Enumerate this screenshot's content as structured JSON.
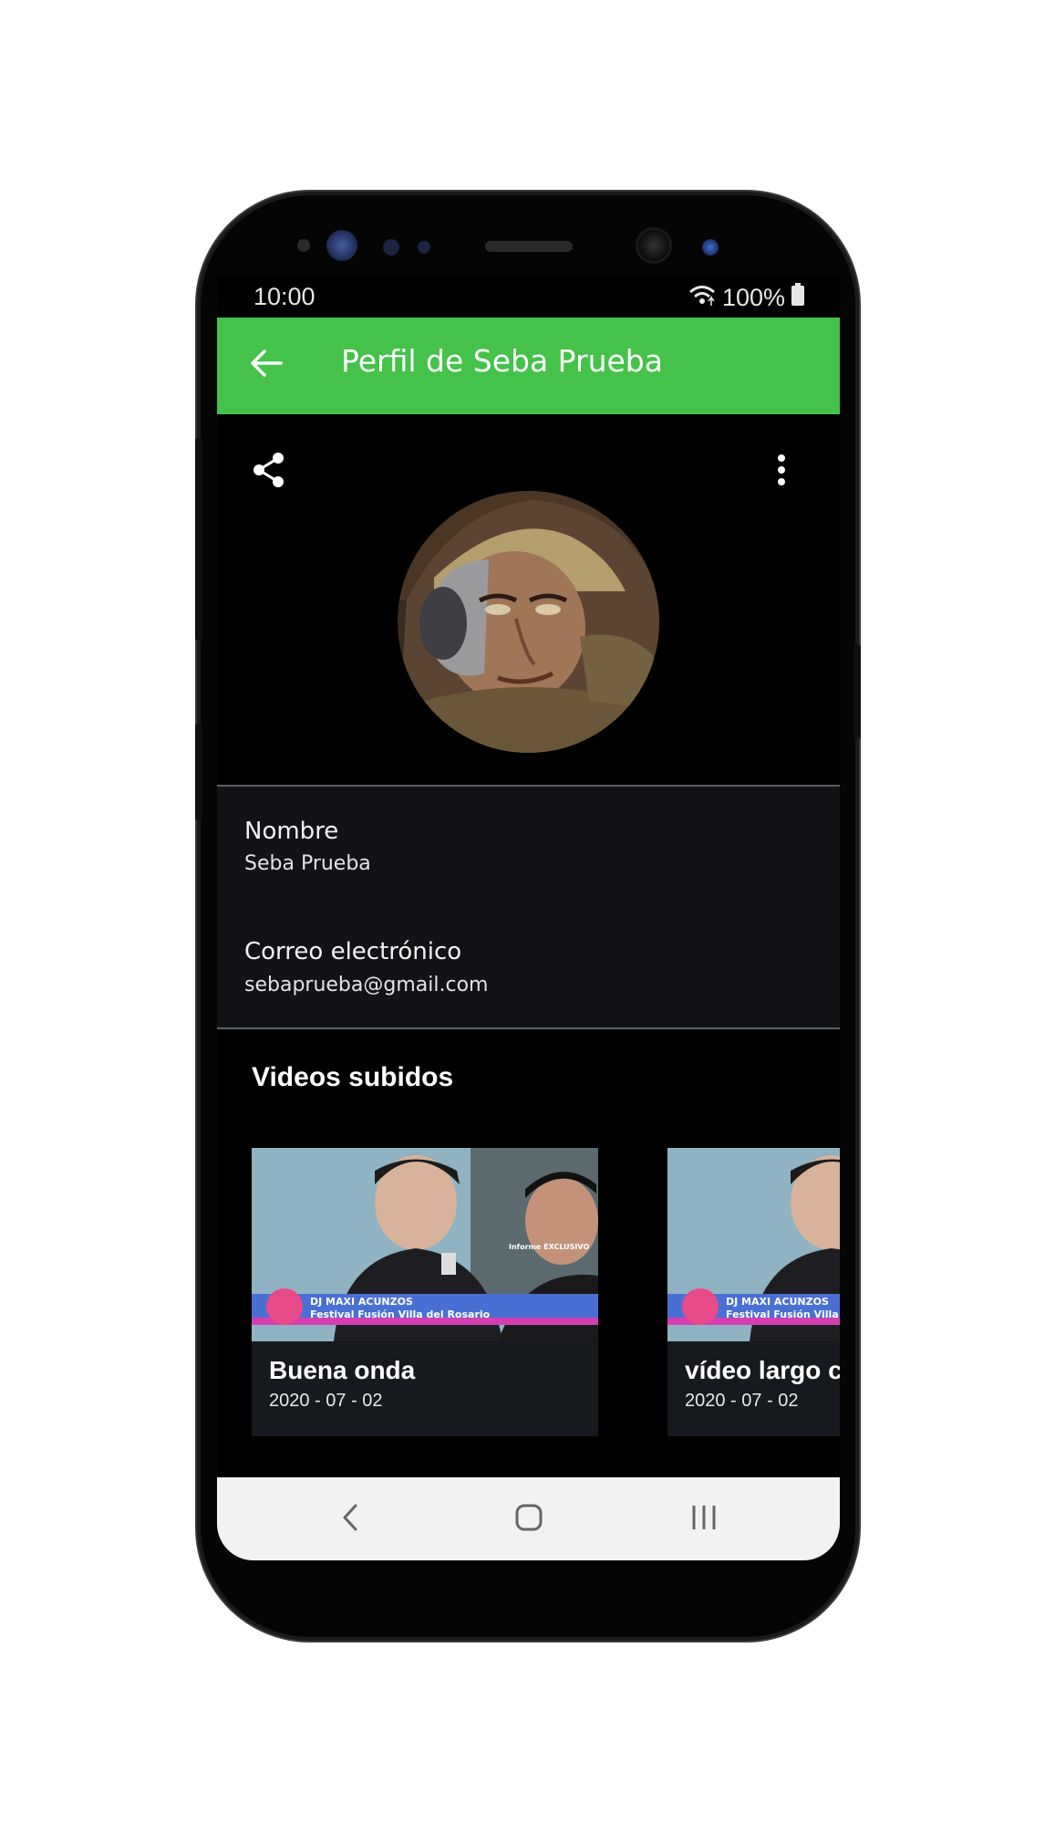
{
  "status_bar": {
    "time": "10:00",
    "battery": "100%"
  },
  "app_bar": {
    "title": "Perfil de Seba Prueba"
  },
  "profile": {
    "name_label": "Nombre",
    "name_value": "Seba Prueba",
    "email_label": "Correo electrónico",
    "email_value": "sebaprueba@gmail.com"
  },
  "videos": {
    "section_title": "Videos subidos",
    "items": [
      {
        "title": "Buena onda",
        "date": "2020 - 07 - 02",
        "thumb_overlay": {
          "tag": "Informe EXCLUSIVO",
          "line1": "DJ MAXI ACUNZOS",
          "line2": "Festival Fusión Villa del Rosario"
        }
      },
      {
        "title": "vídeo largo co",
        "date": "2020 - 07 - 02",
        "thumb_overlay": {
          "tag": "",
          "line1": "DJ MAXI ACUNZOS",
          "line2": "Festival Fusión Villa del I"
        }
      }
    ]
  },
  "colors": {
    "accent": "#44c24a",
    "background": "#000000",
    "panel": "#111317",
    "navbar": "#f2f2f2"
  },
  "icons": [
    "back-arrow-icon",
    "share-icon",
    "more-vert-icon",
    "wifi-icon",
    "battery-icon",
    "nav-back-icon",
    "nav-home-icon",
    "nav-recents-icon"
  ]
}
